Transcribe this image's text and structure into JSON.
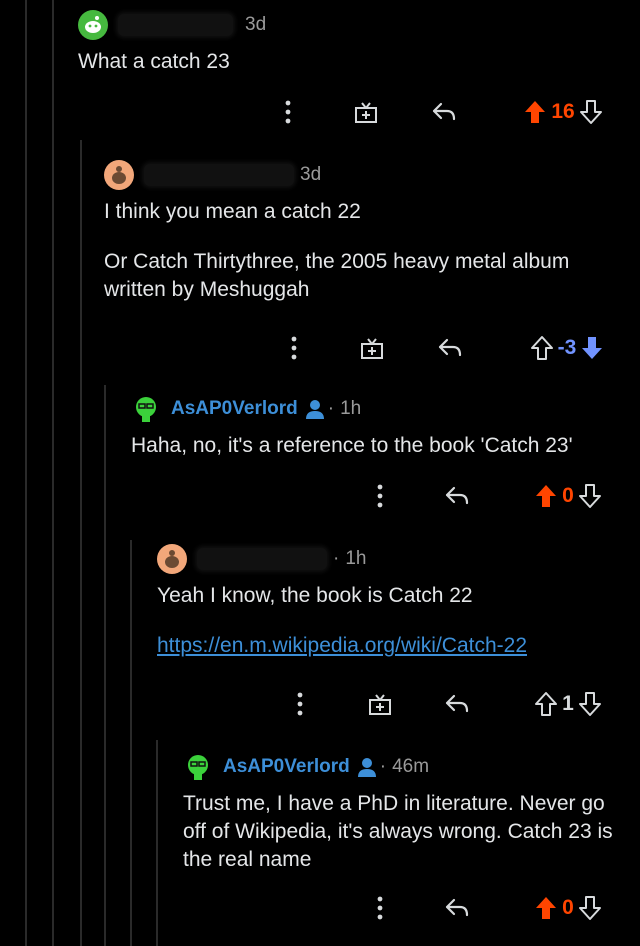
{
  "colors": {
    "upvote": "#ff4500",
    "downvote": "#7193ff",
    "username": "#3d8fd8",
    "muted": "#9a9a9a"
  },
  "comments": [
    {
      "time": "3d",
      "body": [
        "What a catch 23"
      ],
      "score": "16",
      "vote": "up",
      "has_award": true
    },
    {
      "time": "3d",
      "body": [
        "I think you mean a catch 22",
        "Or Catch Thirtythree, the 2005 heavy metal album written by Meshuggah"
      ],
      "score": "-3",
      "vote": "down",
      "has_award": true
    },
    {
      "username": "AsAP0Verlord",
      "time": "1h",
      "body": [
        "Haha, no, it's a reference to the book 'Catch 23'"
      ],
      "score": "0",
      "vote": "up",
      "has_award": false
    },
    {
      "time": "1h",
      "body": [
        "Yeah I know, the book is Catch 22"
      ],
      "link": "https://en.m.wikipedia.org/wiki/Catch-22",
      "score": "1",
      "vote": "none",
      "has_award": true
    },
    {
      "username": "AsAP0Verlord",
      "time": "46m",
      "body": [
        "Trust me, I have a PhD in literature. Never go off of Wikipedia, it's always wrong. Catch 23 is the real name"
      ],
      "score": "0",
      "vote": "up",
      "has_award": false
    }
  ]
}
